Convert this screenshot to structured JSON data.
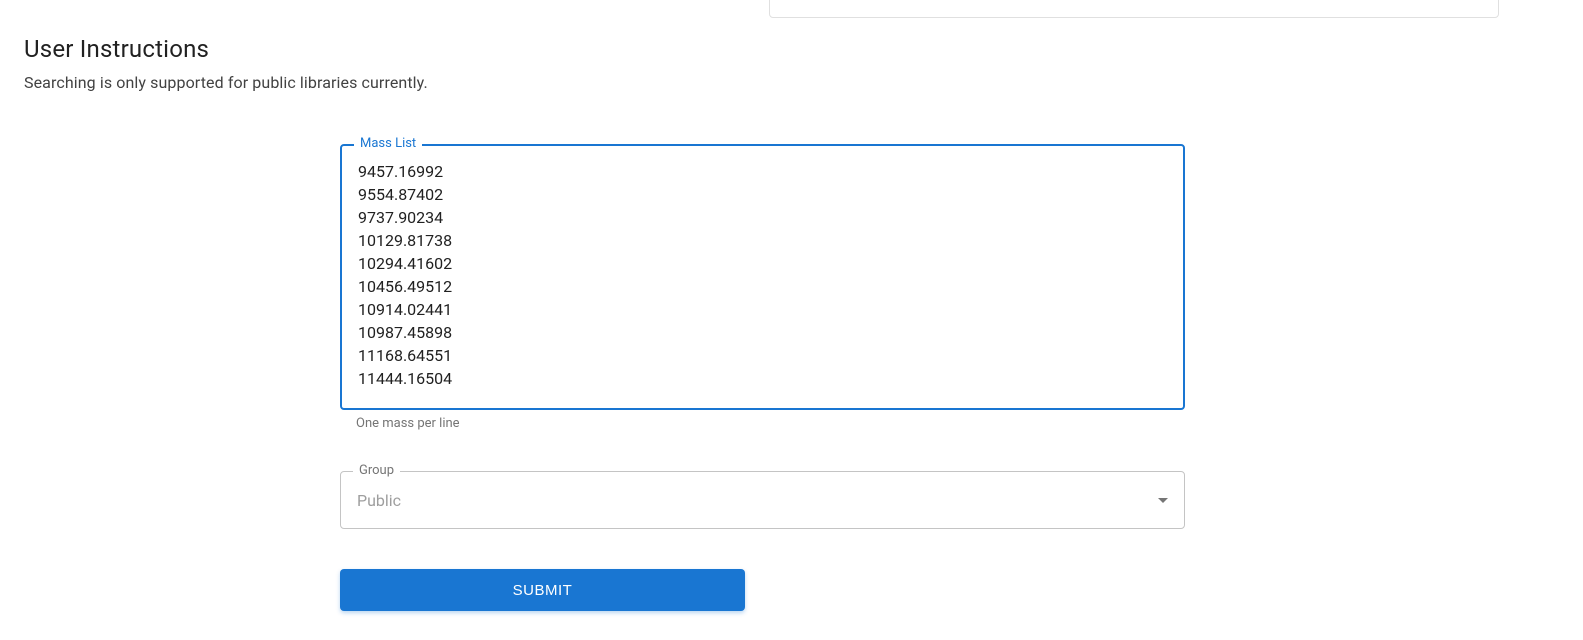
{
  "instructions": {
    "title": "User Instructions",
    "subtitle": "Searching is only supported for public libraries currently."
  },
  "form": {
    "massList": {
      "label": "Mass List",
      "value": "9457.16992\n9554.87402\n9737.90234\n10129.81738\n10294.41602\n10456.49512\n10914.02441\n10987.45898\n11168.64551\n11444.16504",
      "helper": "One mass per line"
    },
    "group": {
      "label": "Group",
      "value": "Public"
    },
    "submit": {
      "label": "SUBMIT"
    }
  }
}
